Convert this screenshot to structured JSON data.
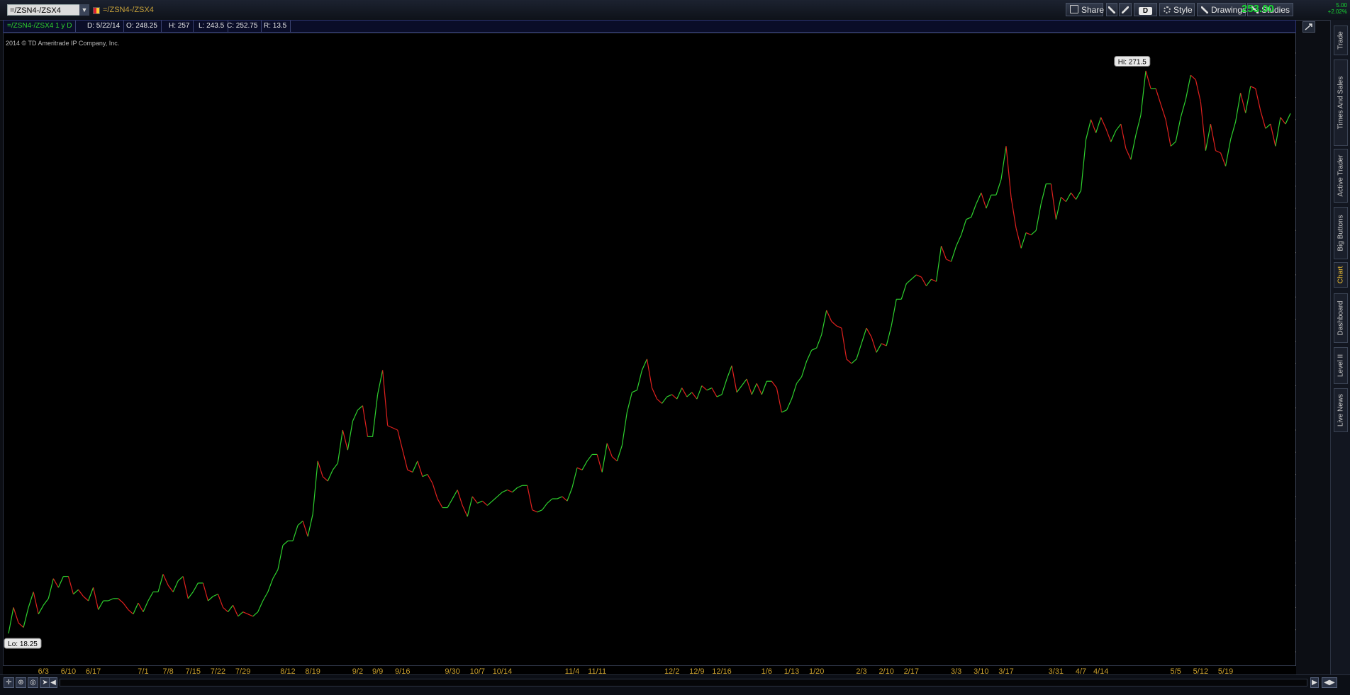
{
  "header": {
    "symbol": "=/ZSN4-/ZSX4",
    "description": "=/ZSN4-/ZSX4",
    "buttons": {
      "share": "Share",
      "aggregation": "D",
      "style": "Style",
      "drawings": "Drawings",
      "studies": "Studies"
    },
    "last_price": "253.00",
    "change": "5.00",
    "change_pct": "+2.02%"
  },
  "infobar": {
    "title": "=/ZSN4-/ZSX4 1 y D",
    "date": "D: 5/22/14",
    "open": "O: 248.25",
    "high": "H: 257",
    "low": "L: 243.5",
    "close": "C: 252.75",
    "range": "R: 13.5"
  },
  "copyright": "2014 © TD Ameritrade IP Company, Inc.",
  "side_tabs": [
    "Trade",
    "Times And Sales",
    "Active Trader",
    "Big Buttons",
    "Chart",
    "Dashboard",
    "Level II",
    "Live News"
  ],
  "active_tab": "Chart",
  "colors": {
    "up": "#2ed12e",
    "down": "#e0201e",
    "background": "#000000",
    "last_price_bubble": "#17d832"
  },
  "chart_data": {
    "type": "line",
    "series": [
      {
        "values": [
          18.25,
          30,
          23,
          21,
          30,
          37,
          27,
          31,
          34,
          43,
          39,
          44,
          44,
          36,
          38,
          35,
          33,
          39,
          29,
          33,
          33,
          34,
          34,
          32,
          29,
          27,
          32,
          28,
          33,
          37,
          37,
          45,
          40,
          37,
          42,
          44,
          34,
          37,
          41,
          41,
          33,
          35,
          36,
          30,
          28,
          31,
          26,
          28,
          27,
          26,
          28,
          33,
          37,
          43,
          47,
          58,
          60,
          60,
          67,
          69,
          62,
          72,
          96,
          89,
          87,
          92,
          95,
          110,
          101,
          114,
          119,
          121,
          107,
          107,
          126,
          137,
          112,
          111,
          110,
          101,
          92,
          91,
          96,
          89,
          90,
          86,
          79,
          75,
          75,
          79,
          83,
          76,
          71,
          80,
          77,
          78,
          76,
          78,
          80,
          82,
          83,
          82,
          84,
          85,
          85,
          74,
          73,
          74,
          77,
          79,
          79,
          80,
          78,
          84,
          93,
          92,
          96,
          99,
          99,
          91,
          104,
          98,
          96,
          103,
          118,
          127,
          128,
          137,
          142,
          129,
          124,
          122,
          125,
          126,
          124,
          129,
          125,
          127,
          124,
          130,
          128,
          129,
          125,
          126,
          133,
          139,
          127,
          130,
          133,
          126,
          131,
          126,
          132,
          132,
          129,
          118,
          119,
          124,
          131,
          134,
          141,
          146,
          147,
          153,
          164,
          159,
          157,
          156,
          142,
          140,
          142,
          149,
          156,
          152,
          145,
          149,
          148,
          157,
          169,
          169,
          176,
          178,
          180,
          179,
          175,
          178,
          177,
          193,
          187,
          186,
          193,
          198,
          205,
          206,
          212,
          217,
          210,
          216,
          216,
          223,
          238,
          215,
          201,
          192,
          199,
          198,
          200,
          212,
          221,
          221,
          205,
          215,
          213,
          217,
          214,
          218,
          241,
          250,
          244,
          251,
          246,
          240,
          245,
          248,
          237,
          232,
          243,
          252,
          272,
          264,
          264,
          257,
          250,
          238,
          240,
          251,
          259,
          270,
          268,
          258,
          236,
          248,
          236,
          235,
          229,
          241,
          249,
          262,
          253,
          265,
          264,
          254,
          246,
          248,
          238,
          251,
          248,
          252.75
        ]
      }
    ],
    "ylim": [
      5,
      285
    ],
    "y_ticks": [
      10,
      20,
      30,
      40,
      50,
      60,
      70,
      80,
      90,
      100,
      110,
      120,
      130,
      140,
      150,
      160,
      170,
      180,
      190,
      200,
      210,
      220,
      230,
      240,
      250,
      260,
      270,
      280
    ],
    "x_ticks": [
      {
        "label": "6/3",
        "i": 7
      },
      {
        "label": "6/10",
        "i": 12
      },
      {
        "label": "6/17",
        "i": 17
      },
      {
        "label": "7/1",
        "i": 27
      },
      {
        "label": "7/8",
        "i": 32
      },
      {
        "label": "7/15",
        "i": 37
      },
      {
        "label": "7/22",
        "i": 42
      },
      {
        "label": "7/29",
        "i": 47
      },
      {
        "label": "8/12",
        "i": 56
      },
      {
        "label": "8/19",
        "i": 61
      },
      {
        "label": "9/2",
        "i": 70
      },
      {
        "label": "9/9",
        "i": 74
      },
      {
        "label": "9/16",
        "i": 79
      },
      {
        "label": "9/30",
        "i": 89
      },
      {
        "label": "10/7",
        "i": 94
      },
      {
        "label": "10/14",
        "i": 99
      },
      {
        "label": "11/4",
        "i": 113
      },
      {
        "label": "11/11",
        "i": 118
      },
      {
        "label": "12/2",
        "i": 133
      },
      {
        "label": "12/9",
        "i": 138
      },
      {
        "label": "12/16",
        "i": 143
      },
      {
        "label": "1/6",
        "i": 152
      },
      {
        "label": "1/13",
        "i": 157
      },
      {
        "label": "1/20",
        "i": 162
      },
      {
        "label": "2/3",
        "i": 171
      },
      {
        "label": "2/10",
        "i": 176
      },
      {
        "label": "2/17",
        "i": 181
      },
      {
        "label": "3/3",
        "i": 190
      },
      {
        "label": "3/10",
        "i": 195
      },
      {
        "label": "3/17",
        "i": 200
      },
      {
        "label": "3/31",
        "i": 210
      },
      {
        "label": "4/7",
        "i": 215
      },
      {
        "label": "4/14",
        "i": 219
      },
      {
        "label": "5/5",
        "i": 234
      },
      {
        "label": "5/12",
        "i": 239
      },
      {
        "label": "5/19",
        "i": 244
      }
    ],
    "hi_label": "Hi: 271.5",
    "hi_value": 271.5,
    "hi_index": 223,
    "lo_label": "Lo: 18.25",
    "lo_value": 18.25,
    "lo_index": 0,
    "last_label": "252.75",
    "grid": false
  }
}
